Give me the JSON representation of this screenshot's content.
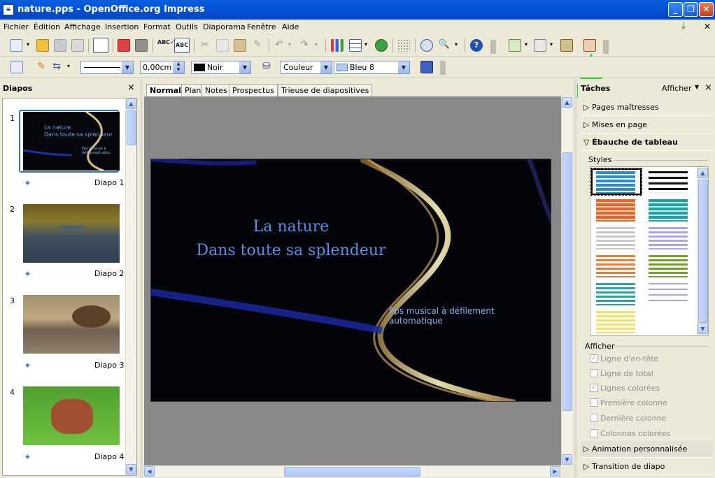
{
  "window": {
    "title": "nature.pps - OpenOffice.org Impress",
    "app_icon": "impress-doc-icon"
  },
  "menu": [
    "Fichier",
    "Édition",
    "Affichage",
    "Insertion",
    "Format",
    "Outils",
    "Diaporama",
    "Fenêtre",
    "Aide"
  ],
  "line_width": "0,00cm",
  "line_color": "Noir",
  "area_style": "Couleur",
  "area_color": "Bleu 8",
  "slides_panel": {
    "title": "Diapos",
    "close": "×"
  },
  "slides": [
    {
      "num": "1",
      "label": "Diapo 1"
    },
    {
      "num": "2",
      "label": "Diapo 2"
    },
    {
      "num": "3",
      "label": "Diapo 3"
    },
    {
      "num": "4",
      "label": "Diapo 4"
    }
  ],
  "view_tabs": [
    "Normal",
    "Plan",
    "Notes",
    "Prospectus",
    "Trieuse de diapositives"
  ],
  "slide": {
    "title_line1": "La nature",
    "title_line2": "Dans toute sa splendeur",
    "subtitle": "Pps musical à défilement automatique"
  },
  "tasks": {
    "title": "Tâches",
    "view_menu": "Afficher",
    "sections": {
      "master": "Pages maîtresses",
      "layouts": "Mises en page",
      "table": "Ébauche de tableau",
      "anim": "Animation personnalisée",
      "transition": "Transition de diapo"
    },
    "styles_label": "Styles",
    "show_label": "Afficher",
    "options": [
      {
        "label": "Ligne d'en-tête",
        "checked": true
      },
      {
        "label": "Ligne de total",
        "checked": false
      },
      {
        "label": "Lignes colorées",
        "checked": true
      },
      {
        "label": "Première colonne",
        "checked": false
      },
      {
        "label": "Dernière colonne",
        "checked": false
      },
      {
        "label": "Colonnes colorées",
        "checked": false
      }
    ]
  },
  "colors": {
    "accent": "#0453d6",
    "title_text": "#5b8ee0",
    "highlight_arrow": "#18e018"
  }
}
